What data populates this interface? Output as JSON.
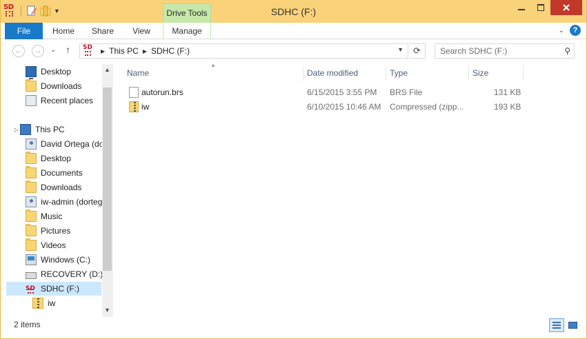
{
  "window": {
    "title": "SDHC (F:)",
    "contextual_tab": "Drive Tools",
    "accent_color": "#1979ca",
    "titlebar_color": "#fad27a"
  },
  "ribbon": {
    "tabs": [
      {
        "label": "File"
      },
      {
        "label": "Home"
      },
      {
        "label": "Share"
      },
      {
        "label": "View"
      },
      {
        "label": "Manage"
      }
    ],
    "help_label": "?"
  },
  "address": {
    "crumbs": [
      "This PC",
      "SDHC (F:)"
    ],
    "search_placeholder": "Search SDHC (F:)"
  },
  "nav_pane": {
    "items": [
      {
        "label": "Desktop",
        "icon": "desktop-icon"
      },
      {
        "label": "Downloads",
        "icon": "downloads-folder-icon"
      },
      {
        "label": "Recent places",
        "icon": "recent-places-icon"
      },
      {
        "label": "This PC",
        "icon": "computer-icon"
      },
      {
        "label": "David Ortega (do",
        "icon": "user-folder-icon"
      },
      {
        "label": "Desktop",
        "icon": "folder-icon"
      },
      {
        "label": "Documents",
        "icon": "folder-icon"
      },
      {
        "label": "Downloads",
        "icon": "folder-icon"
      },
      {
        "label": "iw-admin (dorteg",
        "icon": "user-folder-icon"
      },
      {
        "label": "Music",
        "icon": "folder-icon"
      },
      {
        "label": "Pictures",
        "icon": "folder-icon"
      },
      {
        "label": "Videos",
        "icon": "folder-icon"
      },
      {
        "label": "Windows (C:)",
        "icon": "windows-drive-icon"
      },
      {
        "label": "RECOVERY (D:)",
        "icon": "drive-icon"
      },
      {
        "label": "SDHC (F:)",
        "icon": "sd-card-icon"
      },
      {
        "label": "iw",
        "icon": "zip-folder-icon"
      }
    ]
  },
  "file_list": {
    "columns": [
      "Name",
      "Date modified",
      "Type",
      "Size"
    ],
    "rows": [
      {
        "name": "autorun.brs",
        "date": "6/15/2015 3:55 PM",
        "type": "BRS File",
        "size": "131 KB",
        "icon": "file-icon"
      },
      {
        "name": "iw",
        "date": "6/10/2015 10:46 AM",
        "type": "Compressed (zipp...",
        "size": "193 KB",
        "icon": "zip-folder-icon"
      }
    ]
  },
  "status_bar": {
    "item_count": "2 items"
  }
}
